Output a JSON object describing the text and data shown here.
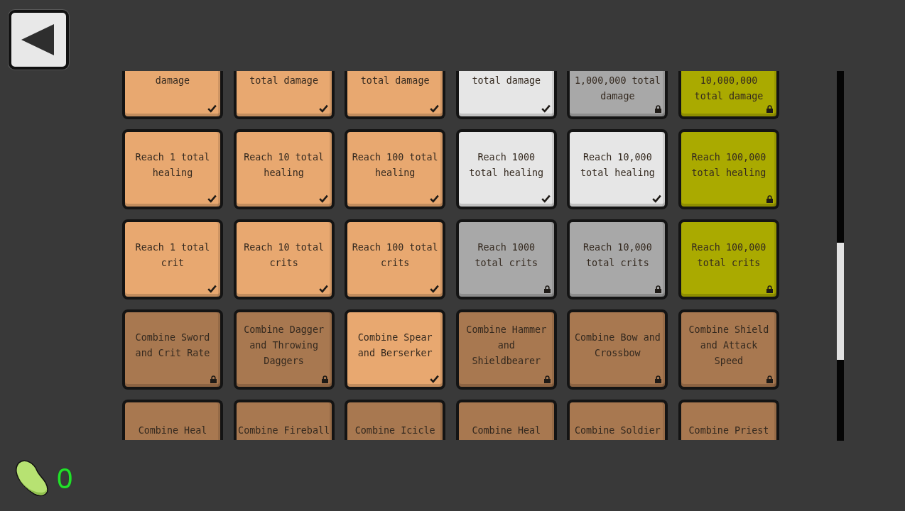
{
  "rows": [
    {
      "tiles": [
        {
          "text": "damage",
          "color": "#e8a870",
          "unlocked": true
        },
        {
          "text": "total damage",
          "color": "#e8a870",
          "unlocked": true
        },
        {
          "text": "total damage",
          "color": "#e8a870",
          "unlocked": true
        },
        {
          "text": "total damage",
          "color": "#e6e6e6",
          "unlocked": true
        },
        {
          "text": "1,000,000 total damage",
          "color": "#a8a8a8",
          "unlocked": false
        },
        {
          "text": "10,000,000 total damage",
          "color": "#aaaa00",
          "unlocked": false
        }
      ]
    },
    {
      "tiles": [
        {
          "text": "Reach 1 total healing",
          "color": "#e8a870",
          "unlocked": true
        },
        {
          "text": "Reach 10 total healing",
          "color": "#e8a870",
          "unlocked": true
        },
        {
          "text": "Reach 100 total healing",
          "color": "#e8a870",
          "unlocked": true
        },
        {
          "text": "Reach 1000 total healing",
          "color": "#e6e6e6",
          "unlocked": true
        },
        {
          "text": "Reach 10,000 total healing",
          "color": "#e6e6e6",
          "unlocked": true
        },
        {
          "text": "Reach 100,000 total healing",
          "color": "#aaaa00",
          "unlocked": false
        }
      ]
    },
    {
      "tiles": [
        {
          "text": "Reach 1 total crit",
          "color": "#e8a870",
          "unlocked": true
        },
        {
          "text": "Reach 10 total crits",
          "color": "#e8a870",
          "unlocked": true
        },
        {
          "text": "Reach 100 total crits",
          "color": "#e8a870",
          "unlocked": true
        },
        {
          "text": "Reach 1000 total crits",
          "color": "#a8a8a8",
          "unlocked": false
        },
        {
          "text": "Reach 10,000 total crits",
          "color": "#a8a8a8",
          "unlocked": false
        },
        {
          "text": "Reach 100,000 total crits",
          "color": "#aaaa00",
          "unlocked": false
        }
      ]
    },
    {
      "tiles": [
        {
          "text": "Combine Sword and Crit Rate",
          "color": "#a87850",
          "unlocked": false
        },
        {
          "text": "Combine Dagger and Throwing Daggers",
          "color": "#a87850",
          "unlocked": false
        },
        {
          "text": "Combine Spear and Berserker",
          "color": "#e8a870",
          "unlocked": true
        },
        {
          "text": "Combine Hammer and Shieldbearer",
          "color": "#a87850",
          "unlocked": false
        },
        {
          "text": "Combine Bow and Crossbow",
          "color": "#a87850",
          "unlocked": false
        },
        {
          "text": "Combine Shield and Attack Speed",
          "color": "#a87850",
          "unlocked": false
        }
      ]
    },
    {
      "tiles": [
        {
          "text": "Combine Heal",
          "color": "#a87850"
        },
        {
          "text": "Combine Fireball",
          "color": "#a87850"
        },
        {
          "text": "Combine Icicle",
          "color": "#a87850"
        },
        {
          "text": "Combine Heal",
          "color": "#a87850"
        },
        {
          "text": "Combine Soldier",
          "color": "#a87850"
        },
        {
          "text": "Combine Priest",
          "color": "#a87850"
        }
      ]
    }
  ],
  "currency": {
    "count": "0"
  }
}
